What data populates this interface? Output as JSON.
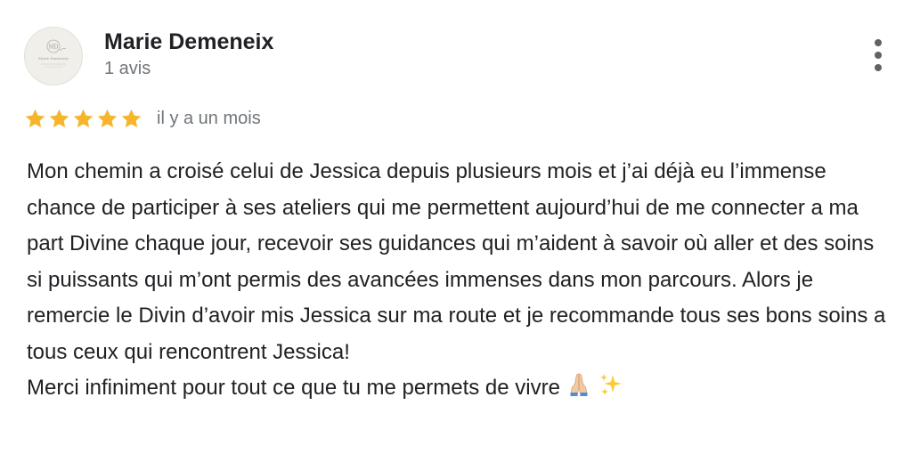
{
  "review": {
    "reviewer_name": "Marie Demeneix",
    "review_count": "1 avis",
    "rating": 5,
    "rating_max": 5,
    "date": "il y a un mois",
    "paragraph1": "Mon chemin a croisé celui de Jessica depuis plusieurs mois et j’ai déjà eu l’immense chance de participer à ses ateliers qui me permettent aujourd’hui de me connecter a ma part Divine chaque jour, recevoir ses guidances qui m’aident à savoir où aller et des soins si puissants qui m’ont permis des avancées immenses dans mon parcours. Alors je remercie le Divin d’avoir mis Jessica sur ma route et je recommande tous ses bons soins a tous ceux qui rencontrent Jessica!",
    "paragraph2": "Merci infiniment pour tout ce que tu me permets de vivre",
    "paragraph2_emojis": [
      "folded-hands-icon",
      "sparkles-icon"
    ],
    "avatar_monogram": "MD",
    "avatar_caption": "Marie Demeneix"
  },
  "icons": {
    "more": "more-vertical-icon",
    "star": "star-icon"
  },
  "colors": {
    "star_fill": "#f7b52c",
    "text_primary": "#202124",
    "text_secondary": "#70757a",
    "menu_dots": "#5f6368",
    "avatar_bg": "#f1efea"
  }
}
